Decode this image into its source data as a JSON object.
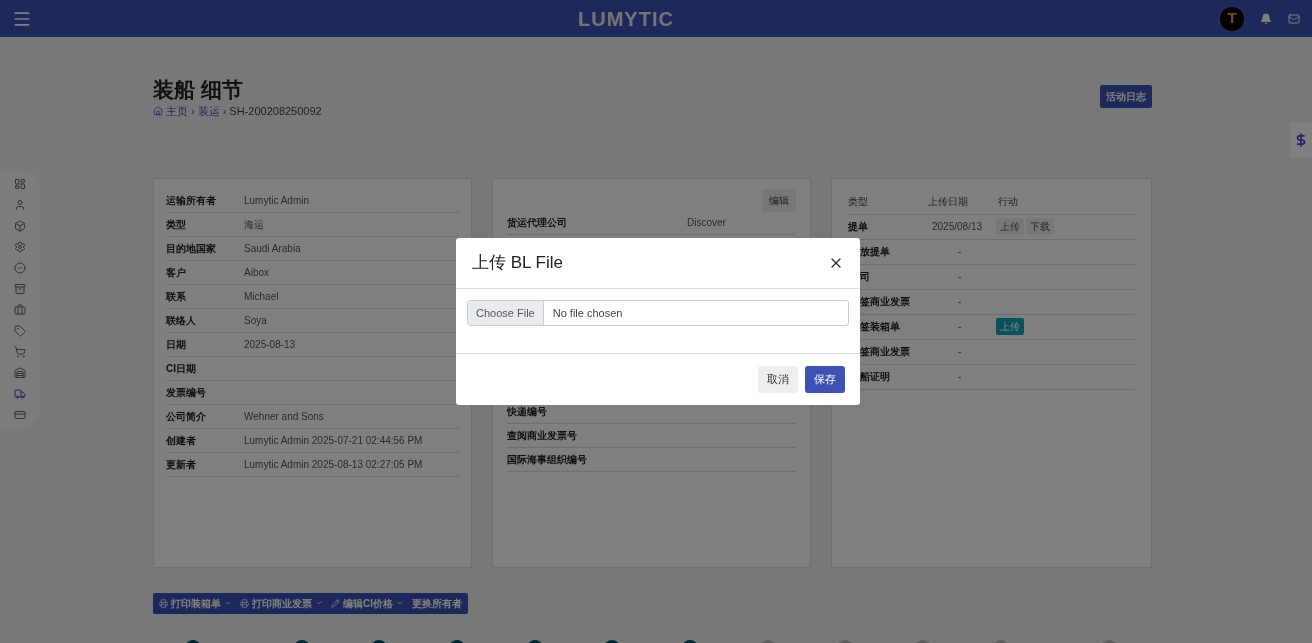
{
  "header": {
    "logo": "LUMYTIC",
    "avatar_letter": "T"
  },
  "page": {
    "title": "装船 细节",
    "breadcrumb": [
      {
        "label": "主页",
        "link": true
      },
      {
        "separator": "›",
        "label": "装运",
        "link": true
      },
      {
        "separator": "›",
        "label": "SH-200208250092",
        "link": false
      }
    ],
    "activity_button": "活动日志"
  },
  "sidebar": {
    "items": [
      {
        "selected": false
      },
      {
        "selected": false
      },
      {
        "selected": false
      },
      {
        "selected": false
      },
      {
        "selected": false
      },
      {
        "selected": false
      },
      {
        "selected": false
      },
      {
        "selected": false
      },
      {
        "selected": false
      },
      {
        "selected": false
      },
      {
        "selected": true
      },
      {
        "selected": false
      }
    ]
  },
  "details_card": {
    "rows": [
      {
        "label": "运输所有者",
        "value": "Lumytic Admin"
      },
      {
        "label": "类型",
        "value": "海运"
      },
      {
        "label": "目的地国家",
        "value": "Saudi Arabia"
      },
      {
        "label": "客户",
        "value": "Aibox"
      },
      {
        "label": "联系",
        "value": "Michael"
      },
      {
        "label": "联络人",
        "value": "Soya"
      },
      {
        "label": "日期",
        "value": "2025-08-13"
      },
      {
        "label": "CI日期"
      },
      {
        "label": "发票编号"
      },
      {
        "label": "公司简介",
        "value": "Wehner and Sons"
      },
      {
        "label": "创建者",
        "value": "Lumytic Admin 2025-07-21 02:44:56 PM"
      },
      {
        "label": "更新者",
        "value": "Lumytic Admin 2025-08-13 02:27:05 PM"
      }
    ]
  },
  "shipping_card": {
    "edit_button": "编辑",
    "top_rows": [
      {
        "label": "货运代理公司",
        "value": "Discover"
      }
    ],
    "bottom_rows": [
      {
        "label": "快递编号"
      },
      {
        "label": "查阅商业发票号"
      },
      {
        "label": "国际海事组织编号"
      }
    ]
  },
  "documents_card": {
    "columns": [
      "类型",
      "上传日期",
      "行动"
    ],
    "rows": [
      {
        "label": "提单",
        "date": "2025/08/13",
        "actions": [
          {
            "label": "上传",
            "kind": "plain"
          },
          {
            "label": "下载",
            "kind": "plain"
          }
        ]
      },
      {
        "label": "放提单",
        "date": "-"
      },
      {
        "label": "司",
        "date": "-"
      },
      {
        "label": "签商业发票",
        "date": "-"
      },
      {
        "label": "签装箱单",
        "date": "-",
        "actions": [
          {
            "label": "上传",
            "kind": "primary"
          }
        ]
      },
      {
        "label": "签商业发票",
        "date": "-"
      },
      {
        "label": "船证明",
        "date": "-"
      }
    ]
  },
  "action_bar": [
    {
      "label": "打印装箱单",
      "kind": "print",
      "dropdown": true
    },
    {
      "label": "打印商业发票",
      "kind": "print",
      "dropdown": true
    },
    {
      "label": "编辑CI价格",
      "kind": "edit",
      "dropdown": true
    },
    {
      "label": "更换所有者",
      "kind": "plain",
      "dropdown": false
    }
  ],
  "stepper": [
    {
      "kind": "done"
    },
    {
      "kind": "done"
    },
    {
      "kind": "done"
    },
    {
      "kind": "done"
    },
    {
      "kind": "done"
    },
    {
      "kind": "done"
    },
    {
      "kind": "current"
    },
    {
      "kind": "pending"
    },
    {
      "kind": "pending"
    },
    {
      "kind": "pending"
    },
    {
      "kind": "pending"
    },
    {
      "kind": "pending"
    }
  ],
  "modal": {
    "title": "上传 BL File",
    "file_button": "Choose File",
    "file_status": "No file chosen",
    "cancel_button": "取消",
    "save_button": "保存"
  }
}
